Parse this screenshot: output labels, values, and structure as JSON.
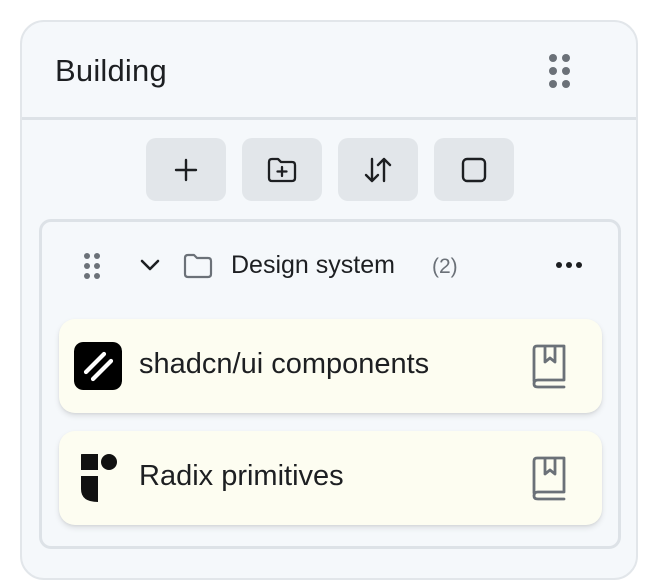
{
  "panel": {
    "title": "Building",
    "drag_handle_icon": "grip-vertical-icon"
  },
  "toolbar": {
    "buttons": [
      {
        "name": "add-item-button",
        "icon": "plus-icon"
      },
      {
        "name": "add-folder-button",
        "icon": "folder-plus-icon"
      },
      {
        "name": "sort-button",
        "icon": "arrow-up-down-icon"
      },
      {
        "name": "select-button",
        "icon": "square-icon"
      }
    ]
  },
  "group": {
    "name": "Design system",
    "count": "(2)",
    "expanded": true,
    "icons": [
      "grip-vertical-icon",
      "chevron-down-icon",
      "folder-icon",
      "more-horizontal-icon"
    ]
  },
  "items": [
    {
      "label": "shadcn/ui components",
      "icon": "shadcn-logo-icon",
      "action_icon": "book-bookmark-icon"
    },
    {
      "label": "Radix primitives",
      "icon": "radix-logo-icon",
      "action_icon": "book-bookmark-icon"
    }
  ],
  "colors": {
    "panel_bg": "#f5f8fb",
    "border": "#dde2e7",
    "button_bg": "#e2e6ea",
    "item_bg": "#fdfdf1",
    "text": "#1d1f22",
    "muted_text": "#6b7178"
  }
}
